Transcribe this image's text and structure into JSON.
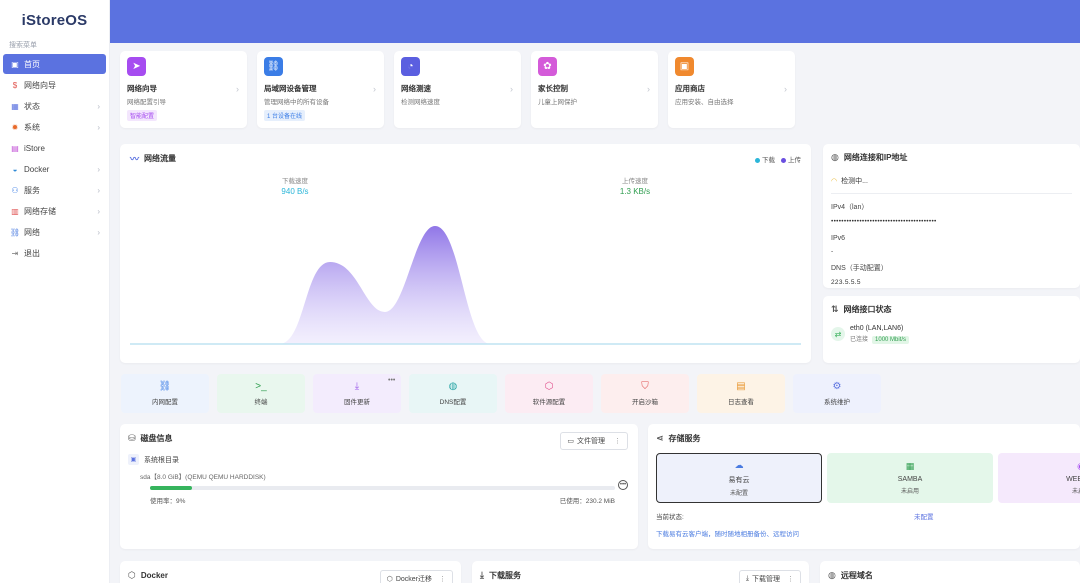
{
  "sidebar": {
    "logo": "iStoreOS",
    "search_label": "搜索菜单",
    "items": [
      {
        "label": "首页",
        "icon": "home-icon",
        "active": true,
        "chevron": false
      },
      {
        "label": "网络向导",
        "icon": "wizard-icon",
        "active": false,
        "chevron": false
      },
      {
        "label": "状态",
        "icon": "grid-icon",
        "active": false,
        "chevron": true
      },
      {
        "label": "系统",
        "icon": "gear-icon",
        "active": false,
        "chevron": true
      },
      {
        "label": "iStore",
        "icon": "store-icon",
        "active": false,
        "chevron": false
      },
      {
        "label": "Docker",
        "icon": "docker-icon",
        "active": false,
        "chevron": true
      },
      {
        "label": "服务",
        "icon": "service-icon",
        "active": false,
        "chevron": true
      },
      {
        "label": "网络存储",
        "icon": "storage-icon",
        "active": false,
        "chevron": true
      },
      {
        "label": "网络",
        "icon": "network-icon",
        "active": false,
        "chevron": true
      },
      {
        "label": "退出",
        "icon": "logout-icon",
        "active": false,
        "chevron": false
      }
    ]
  },
  "quick_cards": [
    {
      "title": "网络向导",
      "sub": "网络配置引导",
      "badge": "智能配置",
      "icon_color": "#a64cf0",
      "badge_bg": "#f3e6fd",
      "badge_fg": "#a64cf0",
      "glyph": "➤"
    },
    {
      "title": "局域网设备管理",
      "sub": "管理网络中的所有设备",
      "badge": "1 台设备在线",
      "icon_color": "#3b7de6",
      "badge_bg": "#e6effc",
      "badge_fg": "#3b7de6",
      "glyph": "⛓"
    },
    {
      "title": "网络测速",
      "sub": "检测网络速度",
      "badge": "",
      "icon_color": "#5b5fe0",
      "glyph": "◔"
    },
    {
      "title": "家长控制",
      "sub": "儿童上网保护",
      "badge": "",
      "icon_color": "#d45bd9",
      "glyph": "✿"
    },
    {
      "title": "应用商店",
      "sub": "应用安装、自由选择",
      "badge": "",
      "icon_color": "#f0892e",
      "glyph": "▣"
    }
  ],
  "traffic": {
    "title": "网络流量",
    "legend_download": "下载",
    "legend_upload": "上传",
    "download_label": "下载速度",
    "download_value": "940 B/s",
    "upload_label": "上传速度",
    "upload_value": "1.3 KB/s",
    "download_color": "#2bb6d9",
    "upload_color": "#6a4fe0"
  },
  "netconn": {
    "title": "网络连接和IP地址",
    "status": "检测中...",
    "ipv4_label": "IPv4（lan）",
    "ipv4_value": "•••••••••••••••••••••••••••••••••••••••••",
    "ipv6_label": "IPv6",
    "ipv6_value": "-",
    "dns_label": "DNS（手动配置）",
    "dns_value": "223.5.5.5"
  },
  "netif": {
    "title": "网络接口状态",
    "name": "eth0 (LAN,LAN6)",
    "state": "已连接",
    "speed": "1000 Mbit/s"
  },
  "tiles": [
    {
      "label": "内网配置",
      "glyph": "⛓",
      "bg": "#edf3fd",
      "color": "#3b7de6"
    },
    {
      "label": "终端",
      "glyph": ">_",
      "bg": "#e9f7ee",
      "color": "#2f9d4f"
    },
    {
      "label": "固件更新",
      "glyph": "⤓",
      "bg": "#f3ecfd",
      "color": "#9b5bea"
    },
    {
      "label": "DNS配置",
      "glyph": "◍",
      "bg": "#e8f6f6",
      "color": "#2aa6a6"
    },
    {
      "label": "软件源配置",
      "glyph": "⬡",
      "bg": "#fcecf3",
      "color": "#e04c8a"
    },
    {
      "label": "开启沙箱",
      "glyph": "⛉",
      "bg": "#fdeeee",
      "color": "#e05252"
    },
    {
      "label": "日志查看",
      "glyph": "▤",
      "bg": "#fdf3e6",
      "color": "#e8952d"
    },
    {
      "label": "系统维护",
      "glyph": "⚙",
      "bg": "#eef1fd",
      "color": "#5b72e0"
    }
  ],
  "tile_more": "•••",
  "disk": {
    "title": "磁盘信息",
    "manage_button": "文件管理",
    "row_title": "系统根目录",
    "row_sub": "sda【8.0 GiB】(QEMU QEMU HARDDISK)",
    "usage_label": "使用率：9%",
    "used_label": "已使用：230.2 MiB",
    "usage_percent": 9
  },
  "storage": {
    "title": "存储服务",
    "tiles": [
      {
        "name": "易有云",
        "status": "未配置",
        "glyph": "☁",
        "bg": "#eef1fb",
        "border": "#333"
      },
      {
        "name": "SAMBA",
        "status": "未启用",
        "glyph": "▦",
        "bg": "#e4f7ea",
        "border": "transparent"
      },
      {
        "name": "WEBDAV",
        "status": "未启用",
        "glyph": "◉",
        "bg": "#f5e9fc",
        "border": "transparent"
      }
    ],
    "current_label": "当前状态:",
    "current_value": "未配置",
    "link_text": "下载易有云客户端，随时随地相册备份、远程访问"
  },
  "bottom": {
    "docker_title": "Docker",
    "docker_button": "Docker迁移",
    "download_title": "下载服务",
    "download_button": "下载管理",
    "domain_title": "远程域名"
  },
  "colors": {
    "accent": "#5b72e0",
    "sidebar_active": "#5b72e0"
  }
}
